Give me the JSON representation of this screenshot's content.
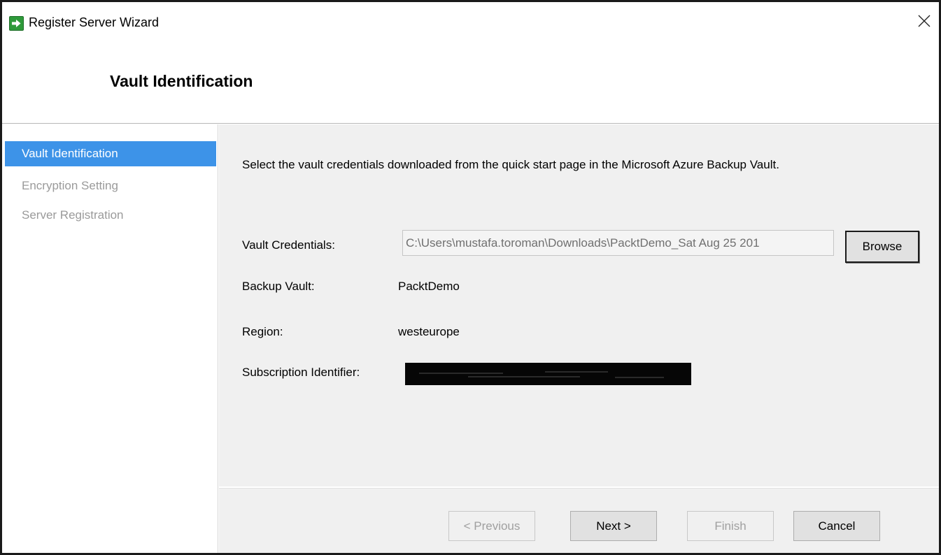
{
  "window": {
    "title": "Register Server Wizard",
    "accent": "#3d93e8",
    "icon": "green-arrow-icon"
  },
  "header": {
    "title": "Vault Identification"
  },
  "nav": {
    "items": [
      {
        "label": "Vault Identification",
        "active": true
      },
      {
        "label": "Encryption Setting",
        "active": false
      },
      {
        "label": "Server Registration",
        "active": false
      }
    ]
  },
  "main": {
    "intro": "Select the vault credentials downloaded from the quick start page in the Microsoft Azure Backup Vault.",
    "credentials": {
      "label": "Vault Credentials:",
      "value": "C:\\Users\\mustafa.toroman\\Downloads\\PacktDemo_Sat Aug 25 201",
      "browse_label": "Browse"
    },
    "backup_vault": {
      "label": "Backup Vault:",
      "value": "PacktDemo"
    },
    "region": {
      "label": "Region:",
      "value": "westeurope"
    },
    "subscription": {
      "label": "Subscription Identifier:"
    }
  },
  "footer": {
    "previous_label": "< Previous",
    "next_label": "Next >",
    "finish_label": "Finish",
    "cancel_label": "Cancel"
  }
}
